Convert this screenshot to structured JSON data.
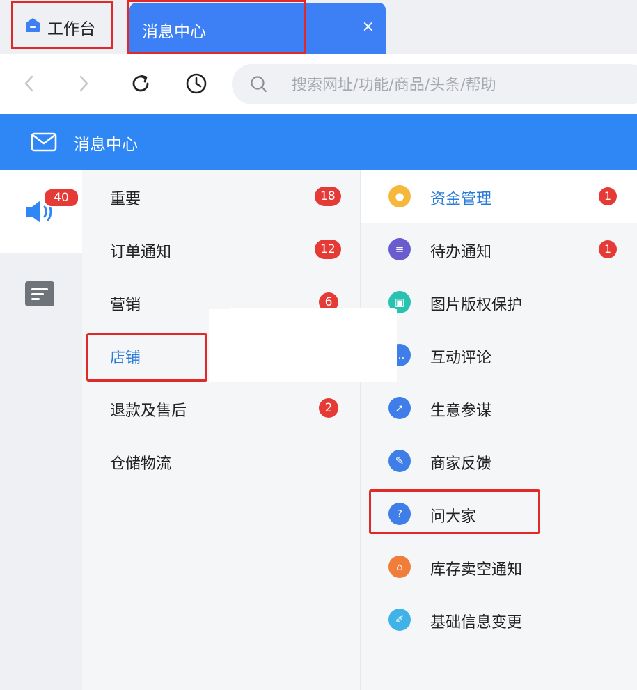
{
  "tabs": {
    "home_label": "工作台",
    "active_label": "消息中心",
    "close_glyph": "×"
  },
  "nav": {
    "search_placeholder": "搜索网址/功能/商品/头条/帮助"
  },
  "header": {
    "title": "消息中心"
  },
  "rail": {
    "badge": "40"
  },
  "categories": [
    {
      "label": "重要",
      "badge": "18"
    },
    {
      "label": "订单通知",
      "badge": "12"
    },
    {
      "label": "营销",
      "badge": "6"
    },
    {
      "label": "店铺",
      "badge": ""
    },
    {
      "label": "退款及售后",
      "badge": "2"
    },
    {
      "label": "仓储物流",
      "badge": ""
    }
  ],
  "subcategories": [
    {
      "label": "资金管理",
      "badge": "1",
      "icon": "money-bag-icon",
      "color": "#f5b83d"
    },
    {
      "label": "待办通知",
      "badge": "1",
      "icon": "todo-icon",
      "color": "#6a5ccf"
    },
    {
      "label": "图片版权保护",
      "badge": "",
      "icon": "image-icon",
      "color": "#29c2b0"
    },
    {
      "label": "互动评论",
      "badge": "",
      "icon": "comment-icon",
      "color": "#3f7ee8"
    },
    {
      "label": "生意参谋",
      "badge": "",
      "icon": "compass-icon",
      "color": "#3f7ee8"
    },
    {
      "label": "商家反馈",
      "badge": "",
      "icon": "feedback-icon",
      "color": "#3f7ee8"
    },
    {
      "label": "问大家",
      "badge": "",
      "icon": "question-icon",
      "color": "#3f7ee8"
    },
    {
      "label": "库存卖空通知",
      "badge": "",
      "icon": "warehouse-icon",
      "color": "#f07d3a"
    },
    {
      "label": "基础信息变更",
      "badge": "",
      "icon": "edit-doc-icon",
      "color": "#3fb3e8"
    }
  ],
  "colors": {
    "accent": "#2f86f5",
    "tab_active": "#3d7ff5",
    "badge": "#e53a35",
    "highlight_outline": "#e02a2a",
    "selected_text": "#2a7bd9"
  }
}
